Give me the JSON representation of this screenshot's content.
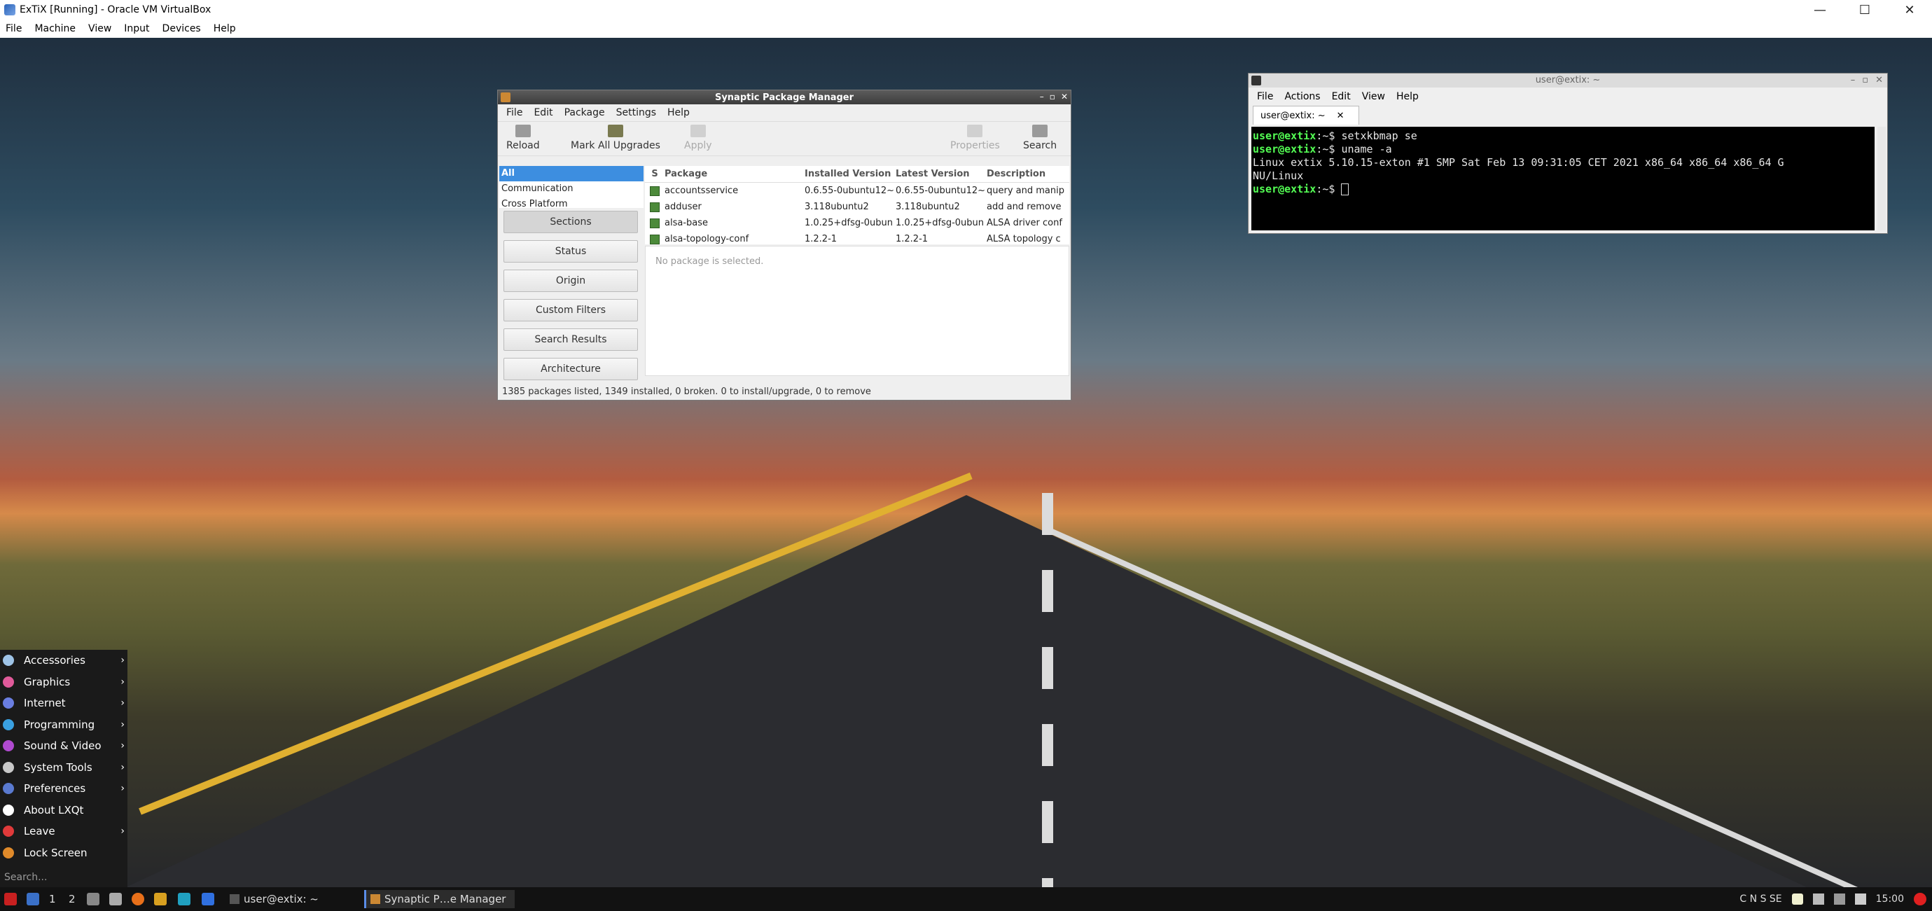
{
  "vbox": {
    "title": "ExTiX [Running] - Oracle VM VirtualBox",
    "menu": [
      "File",
      "Machine",
      "View",
      "Input",
      "Devices",
      "Help"
    ],
    "controls": {
      "minimize": "—",
      "maximize": "☐",
      "close": "✕"
    }
  },
  "synaptic": {
    "title": "Synaptic Package Manager",
    "window_controls": {
      "min": "–",
      "max": "▫",
      "close": "✕"
    },
    "menu": [
      "File",
      "Edit",
      "Package",
      "Settings",
      "Help"
    ],
    "toolbar": {
      "reload": "Reload",
      "mark_all": "Mark All Upgrades",
      "apply": "Apply",
      "properties": "Properties",
      "search": "Search"
    },
    "categories": [
      "All",
      "Communication",
      "Cross Platform"
    ],
    "side_buttons": [
      "Sections",
      "Status",
      "Origin",
      "Custom Filters",
      "Search Results",
      "Architecture"
    ],
    "columns": {
      "s": "S",
      "package": "Package",
      "installed": "Installed Version",
      "latest": "Latest Version",
      "description": "Description"
    },
    "packages": [
      {
        "name": "accountsservice",
        "installed": "0.6.55-0ubuntu12~",
        "latest": "0.6.55-0ubuntu12~",
        "description": "query and manip"
      },
      {
        "name": "adduser",
        "installed": "3.118ubuntu2",
        "latest": "3.118ubuntu2",
        "description": "add and remove"
      },
      {
        "name": "alsa-base",
        "installed": "1.0.25+dfsg-0ubun",
        "latest": "1.0.25+dfsg-0ubun",
        "description": "ALSA driver conf"
      },
      {
        "name": "alsa-topology-conf",
        "installed": "1.2.2-1",
        "latest": "1.2.2-1",
        "description": "ALSA topology c"
      }
    ],
    "detail_text": "No package is selected.",
    "status": "1385 packages listed, 1349 installed, 0 broken. 0 to install/upgrade, 0 to remove"
  },
  "terminal": {
    "title": "user@extix: ~",
    "window_controls": {
      "min": "–",
      "max": "▫",
      "close": "✕"
    },
    "menu": [
      "File",
      "Actions",
      "Edit",
      "View",
      "Help"
    ],
    "tab_label": "user@extix: ~",
    "tab_close": "✕",
    "prompt": "user@extix",
    "prompt_suffix": ":~$ ",
    "commands": [
      "setxkbmap se",
      "uname -a"
    ],
    "output": [
      "Linux extix 5.10.15-exton #1 SMP Sat Feb 13 09:31:05 CET 2021 x86_64 x86_64 x86_64 G",
      "NU/Linux"
    ]
  },
  "startmenu": {
    "items": [
      {
        "label": "Accessories",
        "submenu": true,
        "color": "#9ec3e6"
      },
      {
        "label": "Graphics",
        "submenu": true,
        "color": "#e05a9a"
      },
      {
        "label": "Internet",
        "submenu": true,
        "color": "#6a7ee0"
      },
      {
        "label": "Programming",
        "submenu": true,
        "color": "#3aa0e0"
      },
      {
        "label": "Sound & Video",
        "submenu": true,
        "color": "#b04ad0"
      },
      {
        "label": "System Tools",
        "submenu": true,
        "color": "#c8c8c8"
      },
      {
        "label": "Preferences",
        "submenu": true,
        "color": "#5a7ad0"
      },
      {
        "label": "About LXQt",
        "submenu": false,
        "color": "#ffffff"
      },
      {
        "label": "Leave",
        "submenu": true,
        "color": "#e03a3a"
      },
      {
        "label": "Lock Screen",
        "submenu": false,
        "color": "#e08a2a"
      }
    ],
    "arrow": "›",
    "search_placeholder": "Search..."
  },
  "taskbar": {
    "desktops": [
      "1",
      "2"
    ],
    "tasks": [
      {
        "label": "user@extix: ~"
      },
      {
        "label": "Synaptic P…e Manager"
      }
    ],
    "tray_text": "C N S SE",
    "clock": "15:00"
  }
}
